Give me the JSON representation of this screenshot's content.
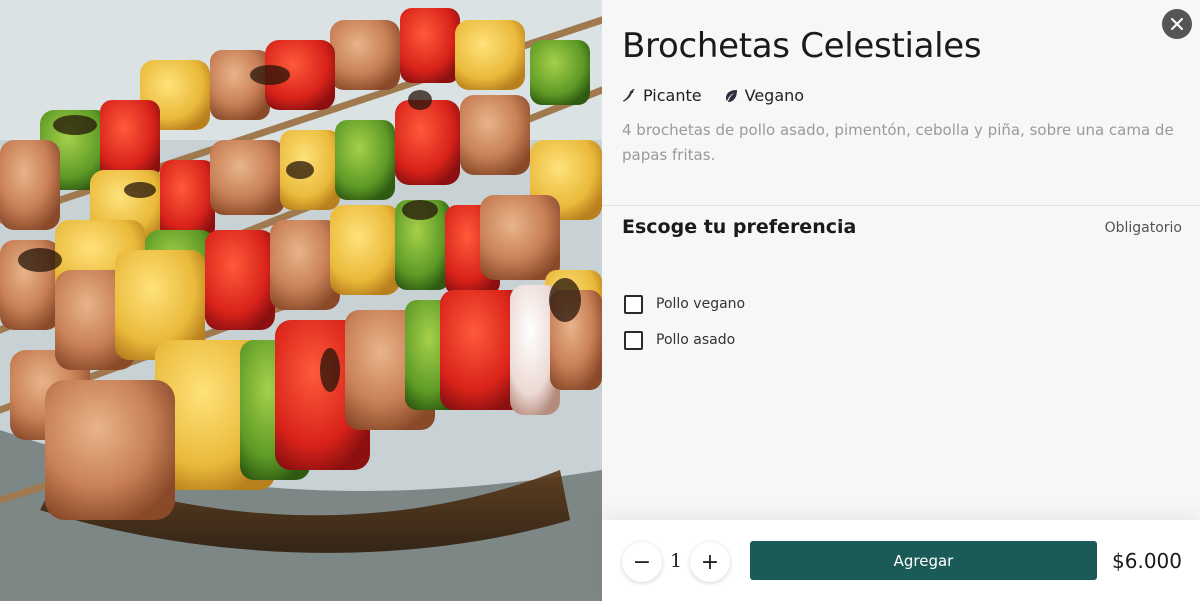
{
  "product": {
    "title": "Brochetas Celestiales",
    "tags": [
      {
        "icon": "chili-pepper-icon",
        "label": "Picante"
      },
      {
        "icon": "leaf-icon",
        "label": "Vegano"
      }
    ],
    "description": "4 brochetas de pollo asado, pimentón, cebolla y piña, sobre una cama de papas fritas."
  },
  "preference": {
    "title": "Escoge tu preferencia",
    "required_label": "Obligatorio",
    "options": [
      {
        "label": "Pollo vegano",
        "checked": false
      },
      {
        "label": "Pollo asado",
        "checked": false
      }
    ]
  },
  "footer": {
    "minus_symbol": "−",
    "quantity": "1",
    "plus_symbol": "+",
    "add_label": "Agregar",
    "price": "$6.000"
  },
  "colors": {
    "primary": "#1b5b57",
    "close_bg": "#555555",
    "panel_bg": "#f7f7f7"
  }
}
